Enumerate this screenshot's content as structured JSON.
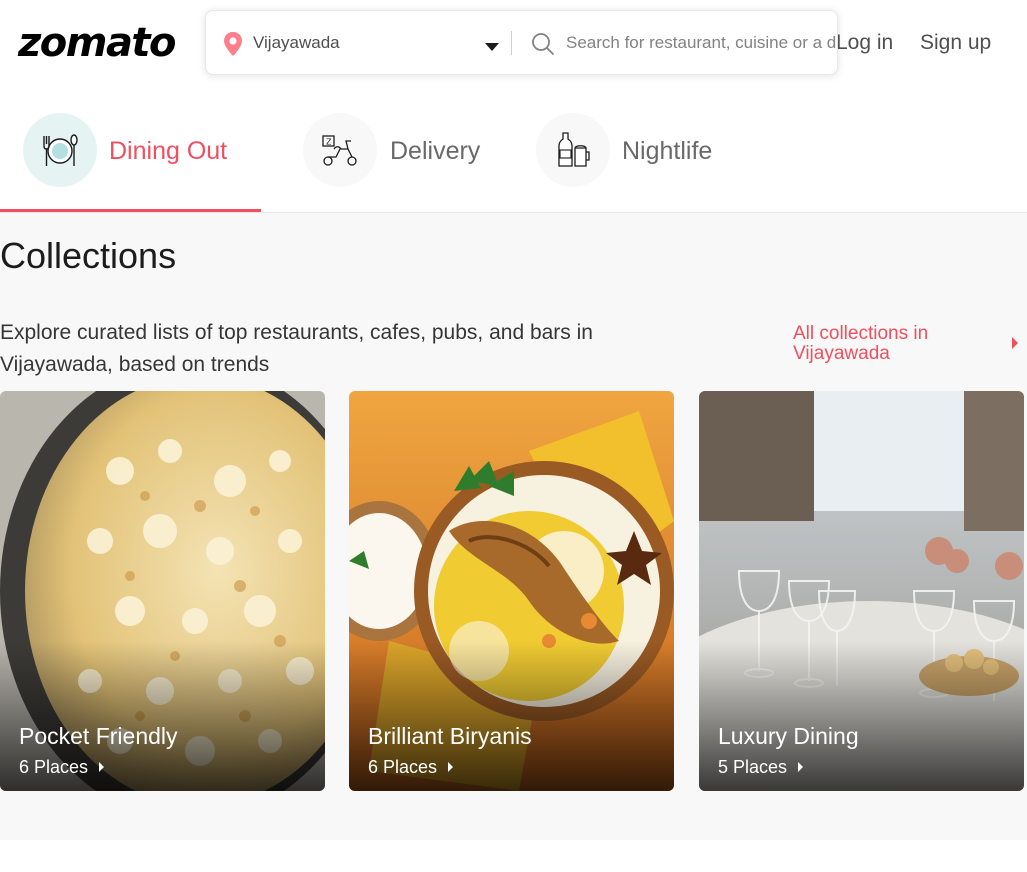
{
  "header": {
    "logo": "zomato",
    "login_label": "Log in",
    "signup_label": "Sign up"
  },
  "search": {
    "location": "Vijayawada",
    "placeholder": "Search for restaurant, cuisine or a dish",
    "value": ""
  },
  "tabs": [
    {
      "label": "Dining Out",
      "icon": "dining-icon",
      "active": true
    },
    {
      "label": "Delivery",
      "icon": "scooter-icon",
      "active": false
    },
    {
      "label": "Nightlife",
      "icon": "drinks-icon",
      "active": false
    }
  ],
  "collections": {
    "title": "Collections",
    "description": "Explore curated lists of top restaurants, cafes, pubs, and bars in Vijayawada, based on trends",
    "all_link": "All collections in Vijayawada",
    "cards": [
      {
        "title": "Pocket Friendly",
        "places": "6 Places"
      },
      {
        "title": "Brilliant Biryanis",
        "places": "6 Places"
      },
      {
        "title": "Luxury Dining",
        "places": "5 Places"
      }
    ]
  },
  "colors": {
    "accent": "#ef4f5f",
    "text": "#1c1c1c",
    "muted": "#696969",
    "section_bg": "#f8f8f8"
  }
}
